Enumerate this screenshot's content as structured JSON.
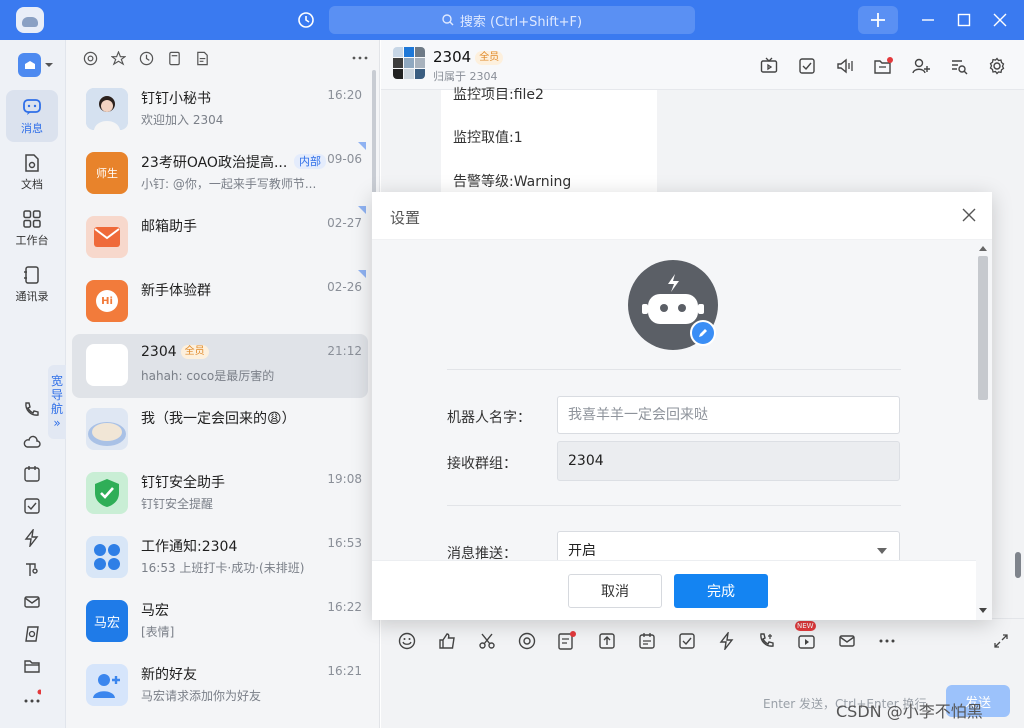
{
  "search": {
    "placeholder": "搜索 (Ctrl+Shift+F)"
  },
  "nav": {
    "items": [
      {
        "label": "消息",
        "icon": "message-icon"
      },
      {
        "label": "文档",
        "icon": "document-icon"
      },
      {
        "label": "工作台",
        "icon": "workbench-icon"
      },
      {
        "label": "通讯录",
        "icon": "contacts-icon"
      }
    ],
    "guide": [
      "宽",
      "导",
      "航",
      "»"
    ]
  },
  "conversations": [
    {
      "title": "钉钉小秘书",
      "sub": "欢迎加入 2304",
      "time": "16:20"
    },
    {
      "title": "23考研OAO政治提高...",
      "tag": "内部",
      "sub": "小钉: @你，一起来手写教师节...",
      "time": "09-06",
      "avatar_text": "师生"
    },
    {
      "title": "邮箱助手",
      "sub": "",
      "time": "02-27"
    },
    {
      "title": "新手体验群",
      "sub": "",
      "time": "02-26",
      "avatar_text": "Hi"
    },
    {
      "title": "2304",
      "tag": "全员",
      "sub": "hahah: coco是最厉害的",
      "time": "21:12"
    },
    {
      "title": "我（我一定会回来的😩）",
      "sub": "",
      "time": ""
    },
    {
      "title": "钉钉安全助手",
      "sub": "钉钉安全提醒",
      "time": "19:08"
    },
    {
      "title": "工作通知:2304",
      "sub": "16:53 上班打卡·成功·(未排班)",
      "time": "16:53"
    },
    {
      "title": "马宏",
      "sub": "[表情]",
      "time": "16:22",
      "avatar_text": "马宏"
    },
    {
      "title": "新的好友",
      "sub": "马宏请求添加你为好友",
      "time": "16:21"
    }
  ],
  "chat": {
    "title": "2304",
    "tag": "全员",
    "subtitle": "归属于 2304",
    "message_lines": [
      "监控项目:file2",
      "监控取值:1",
      "告警等级:Warning"
    ],
    "send_hint": "Enter 发送，Ctrl+Enter 换行",
    "send_label": "发送",
    "badge_new": "NEW"
  },
  "modal": {
    "title": "设置",
    "robot_name_label": "机器人名字：",
    "robot_name_placeholder": "我喜羊羊一定会回来哒",
    "group_label": "接收群组：",
    "group_value": "2304",
    "push_label": "消息推送：",
    "push_value": "开启",
    "cancel_label": "取消",
    "ok_label": "完成"
  },
  "watermark": "CSDN @小李不怕黑",
  "colors": {
    "brand": "#3a7af0",
    "primary_button": "#1484f2",
    "notification_dot": "#e3393c"
  }
}
